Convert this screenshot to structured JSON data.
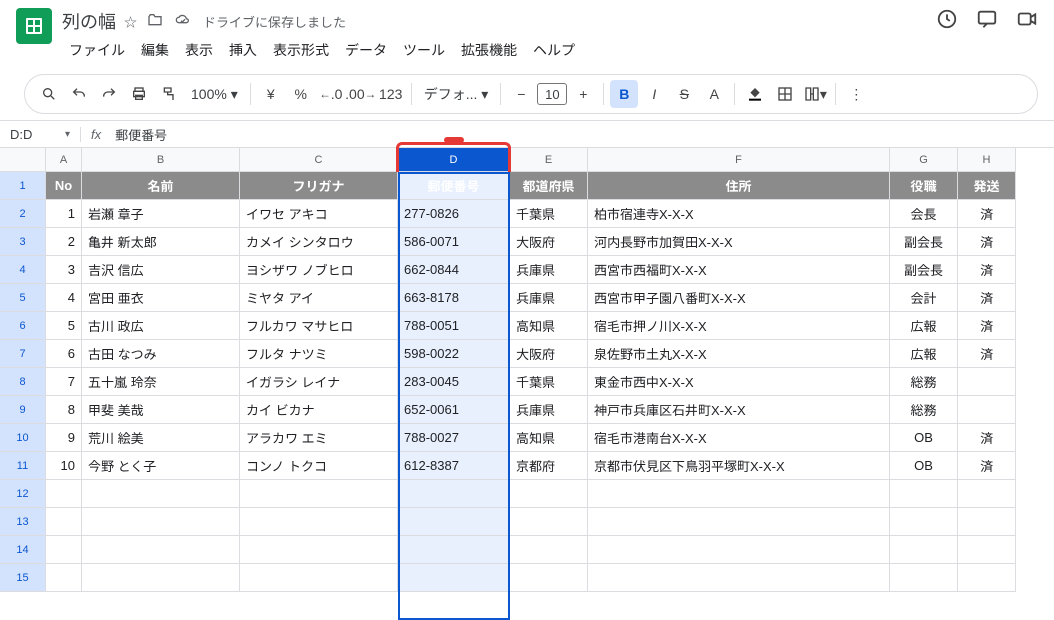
{
  "doc": {
    "title": "列の幅",
    "save_status": "ドライブに保存しました"
  },
  "menus": {
    "file": "ファイル",
    "edit": "編集",
    "view": "表示",
    "insert": "挿入",
    "format": "表示形式",
    "data": "データ",
    "tools": "ツール",
    "extensions": "拡張機能",
    "help": "ヘルプ"
  },
  "toolbar": {
    "zoom": "100%",
    "currency": "¥",
    "percent": "%",
    "dec_dec": ".0",
    "inc_dec": ".00",
    "num_fmt": "123",
    "font": "デフォ...",
    "font_size": "10"
  },
  "namebox": {
    "ref": "D:D",
    "fx": "fx",
    "value": "郵便番号"
  },
  "cols": [
    "A",
    "B",
    "C",
    "D",
    "E",
    "F",
    "G",
    "H"
  ],
  "headers": {
    "no": "No",
    "name": "名前",
    "furigana": "フリガナ",
    "postal": "郵便番号",
    "pref": "都道府県",
    "addr": "住所",
    "role": "役職",
    "ship": "発送"
  },
  "rows": [
    {
      "no": "1",
      "name": "岩瀬 章子",
      "furi": "イワセ アキコ",
      "post": "277-0826",
      "pref": "千葉県",
      "addr": "柏市宿連寺X-X-X",
      "role": "会長",
      "ship": "済"
    },
    {
      "no": "2",
      "name": "亀井 新太郎",
      "furi": "カメイ シンタロウ",
      "post": "586-0071",
      "pref": "大阪府",
      "addr": "河内長野市加賀田X-X-X",
      "role": "副会長",
      "ship": "済"
    },
    {
      "no": "3",
      "name": "吉沢 信広",
      "furi": "ヨシザワ ノブヒロ",
      "post": "662-0844",
      "pref": "兵庫県",
      "addr": "西宮市西福町X-X-X",
      "role": "副会長",
      "ship": "済"
    },
    {
      "no": "4",
      "name": "宮田 亜衣",
      "furi": "ミヤタ アイ",
      "post": "663-8178",
      "pref": "兵庫県",
      "addr": "西宮市甲子園八番町X-X-X",
      "role": "会計",
      "ship": "済"
    },
    {
      "no": "5",
      "name": "古川 政広",
      "furi": "フルカワ マサヒロ",
      "post": "788-0051",
      "pref": "高知県",
      "addr": "宿毛市押ノ川X-X-X",
      "role": "広報",
      "ship": "済"
    },
    {
      "no": "6",
      "name": "古田 なつみ",
      "furi": "フルタ ナツミ",
      "post": "598-0022",
      "pref": "大阪府",
      "addr": "泉佐野市土丸X-X-X",
      "role": "広報",
      "ship": "済"
    },
    {
      "no": "7",
      "name": "五十嵐 玲奈",
      "furi": "イガラシ レイナ",
      "post": "283-0045",
      "pref": "千葉県",
      "addr": "東金市西中X-X-X",
      "role": "総務",
      "ship": ""
    },
    {
      "no": "8",
      "name": "甲斐 美哉",
      "furi": "カイ ビカナ",
      "post": "652-0061",
      "pref": "兵庫県",
      "addr": "神戸市兵庫区石井町X-X-X",
      "role": "総務",
      "ship": ""
    },
    {
      "no": "9",
      "name": "荒川 絵美",
      "furi": "アラカワ エミ",
      "post": "788-0027",
      "pref": "高知県",
      "addr": "宿毛市港南台X-X-X",
      "role": "OB",
      "ship": "済"
    },
    {
      "no": "10",
      "name": "今野 とく子",
      "furi": "コンノ トクコ",
      "post": "612-8387",
      "pref": "京都府",
      "addr": "京都市伏見区下鳥羽平塚町X-X-X",
      "role": "OB",
      "ship": "済"
    }
  ],
  "empty_rows": [
    "12",
    "13",
    "14",
    "15"
  ]
}
